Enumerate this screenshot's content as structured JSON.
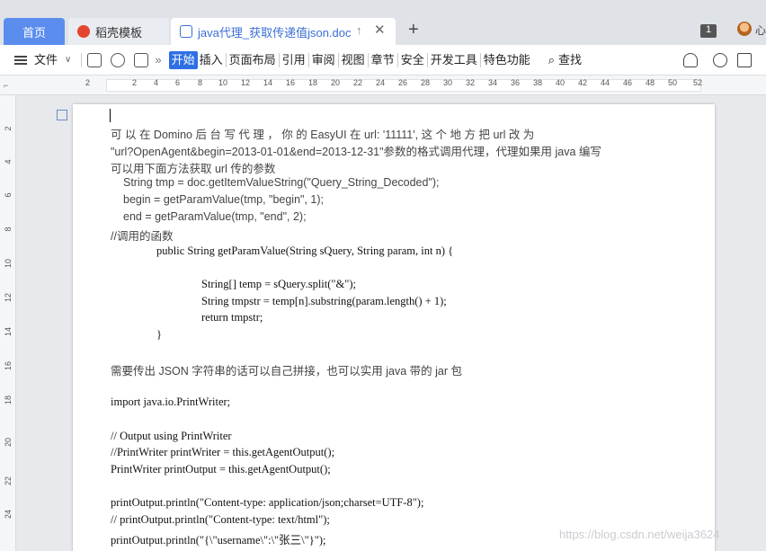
{
  "tabs": {
    "home": "首页",
    "template": "稻壳模板",
    "doc": "java代理_获取传递值json.doc",
    "window_count": "1",
    "user_initial": "心"
  },
  "menu": {
    "file": "文件",
    "items": [
      "开始",
      "插入",
      "页面布局",
      "引用",
      "审阅",
      "视图",
      "章节",
      "安全",
      "开发工具",
      "特色功能"
    ],
    "search": "查找"
  },
  "ruler": {
    "h_numbers": [
      "2",
      "2",
      "4",
      "6",
      "8",
      "10",
      "12",
      "14",
      "16",
      "18",
      "20",
      "22",
      "24",
      "26",
      "28",
      "30",
      "32",
      "34",
      "36",
      "38",
      "40",
      "42",
      "44",
      "46",
      "48",
      "50",
      "52"
    ],
    "v_numbers": [
      "2",
      "4",
      "6",
      "8",
      "10",
      "12",
      "14",
      "16",
      "18",
      "20",
      "22",
      "24"
    ]
  },
  "document": {
    "lines": [
      "可 以 在  Domino  后 台 写 代 理 ， 你 的  EasyUI  在   url:  '11111',  这 个 地 方 把  url  改 为",
      "\"url?OpenAgent&begin=2013-01-01&end=2013-12-31\"参数的格式调用代理，代理如果用 java 编写",
      "可以用下面方法获取 url 传的参数",
      "String tmp = doc.getItemValueString(\"Query_String_Decoded\");",
      "begin = getParamValue(tmp, \"begin\", 1);",
      "end = getParamValue(tmp, \"end\", 2);",
      "//调用的函数",
      "public String getParamValue(String sQuery, String param, int n) {",
      "String[] temp = sQuery.split(\"&\");",
      "String tmpstr = temp[n].substring(param.length() + 1);",
      "return tmpstr;",
      "}",
      "需要传出 JSON 字符串的话可以自己拼接，也可以实用 java 带的 jar 包",
      "import java.io.PrintWriter;",
      "// Output using PrintWriter",
      "//PrintWriter printWriter = this.getAgentOutput();",
      "PrintWriter printOutput = this.getAgentOutput();",
      "printOutput.println(\"Content-type: application/json;charset=UTF-8\");",
      "// printOutput.println(\"Content-type: text/html\");",
      "printOutput.println(\"{\\\"username\\\":\\\"张三\\\"}\");"
    ]
  },
  "watermark": "https://blog.csdn.net/weija3624"
}
